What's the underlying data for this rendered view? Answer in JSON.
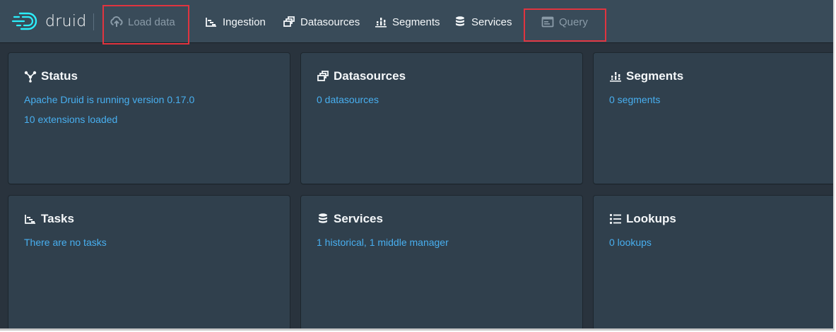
{
  "app": {
    "logo_text": "druid",
    "brand_color": "#48aff0",
    "highlight_color": "#e0343f"
  },
  "navbar": {
    "items": [
      {
        "label": "Load data",
        "icon": "cloud-upload-icon",
        "disabled": true
      },
      {
        "label": "Ingestion",
        "icon": "gantt-chart-icon",
        "disabled": false
      },
      {
        "label": "Datasources",
        "icon": "multi-select-icon",
        "disabled": false
      },
      {
        "label": "Segments",
        "icon": "stacked-chart-icon",
        "disabled": false
      },
      {
        "label": "Services",
        "icon": "database-icon",
        "disabled": false
      },
      {
        "label": "Query",
        "icon": "application-icon",
        "disabled": true
      }
    ]
  },
  "cards": [
    {
      "title": "Status",
      "icon": "graph-icon",
      "lines": [
        "Apache Druid is running version 0.17.0",
        "10 extensions loaded"
      ]
    },
    {
      "title": "Datasources",
      "icon": "multi-select-icon",
      "lines": [
        "0 datasources"
      ]
    },
    {
      "title": "Segments",
      "icon": "stacked-chart-icon",
      "lines": [
        "0 segments"
      ]
    },
    {
      "title": "Tasks",
      "icon": "gantt-chart-icon",
      "lines": [
        "There are no tasks"
      ]
    },
    {
      "title": "Services",
      "icon": "database-icon",
      "lines": [
        "1 historical, 1 middle manager"
      ]
    },
    {
      "title": "Lookups",
      "icon": "properties-icon",
      "lines": [
        "0 lookups"
      ]
    }
  ]
}
